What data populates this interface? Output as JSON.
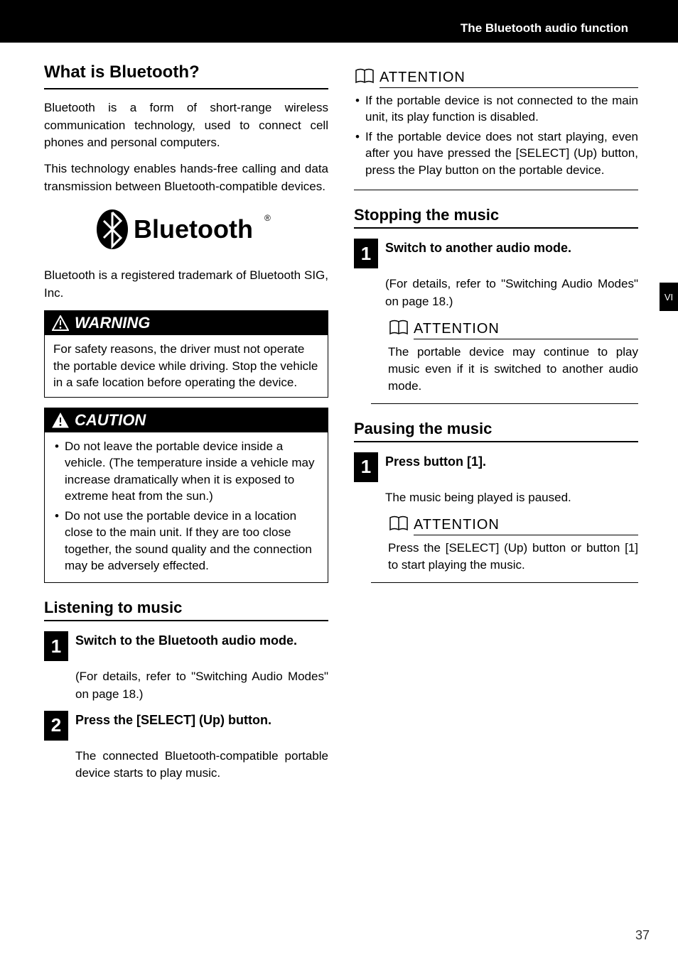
{
  "header": {
    "section_title": "The Bluetooth audio function"
  },
  "side_tab": "VI",
  "left": {
    "h_what": "What is Bluetooth?",
    "p1": "Bluetooth is a form of short-range wireless communication technology, used to connect cell phones and personal computers.",
    "p2": "This technology enables hands-free calling and data transmission between Bluetooth-compatible devices.",
    "bt_word": "Bluetooth",
    "trademark": "Bluetooth is a registered trademark of Bluetooth SIG, Inc.",
    "warning_label": "WARNING",
    "warning_body": "For safety reasons, the driver must not operate the portable device while driving. Stop the vehicle in a safe location before operating the device.",
    "caution_label": "CAUTION",
    "caution_b1": "Do not leave the portable device inside a vehicle. (The temperature inside a vehicle may increase dramatically when it is exposed to extreme heat from the sun.)",
    "caution_b2": "Do not use the portable device in a location close to the main unit. If they are too close together, the sound quality and the connection may be adversely effected.",
    "h_listen": "Listening to music",
    "step1_num": "1",
    "step1_title": "Switch to the Bluetooth audio mode.",
    "step1_body": "(For details, refer to \"Switching Audio Modes\" on page 18.)",
    "step2_num": "2",
    "step2_title": "Press the [SELECT] (Up) button.",
    "step2_body": "The connected Bluetooth-compatible portable device starts to play music."
  },
  "right": {
    "attention_label": "ATTENTION",
    "att1_b1": "If the portable device is not connected to the main unit, its play function is disabled.",
    "att1_b2": "If the portable device does not start playing, even after you have pressed the [SELECT] (Up) button, press the Play button on the portable device.",
    "h_stop": "Stopping the music",
    "stop_step_num": "1",
    "stop_step_title": "Switch to another audio mode.",
    "stop_step_body": "(For details, refer to \"Switching Audio Modes\" on page 18.)",
    "att2_body": "The portable device may continue to play music even if it is switched to another audio mode.",
    "h_pause": "Pausing the music",
    "pause_step_num": "1",
    "pause_step_title": "Press button [1].",
    "pause_step_body": "The music being played is paused.",
    "att3_body": "Press the [SELECT] (Up) button or button [1] to start playing the music."
  },
  "page_number": "37"
}
